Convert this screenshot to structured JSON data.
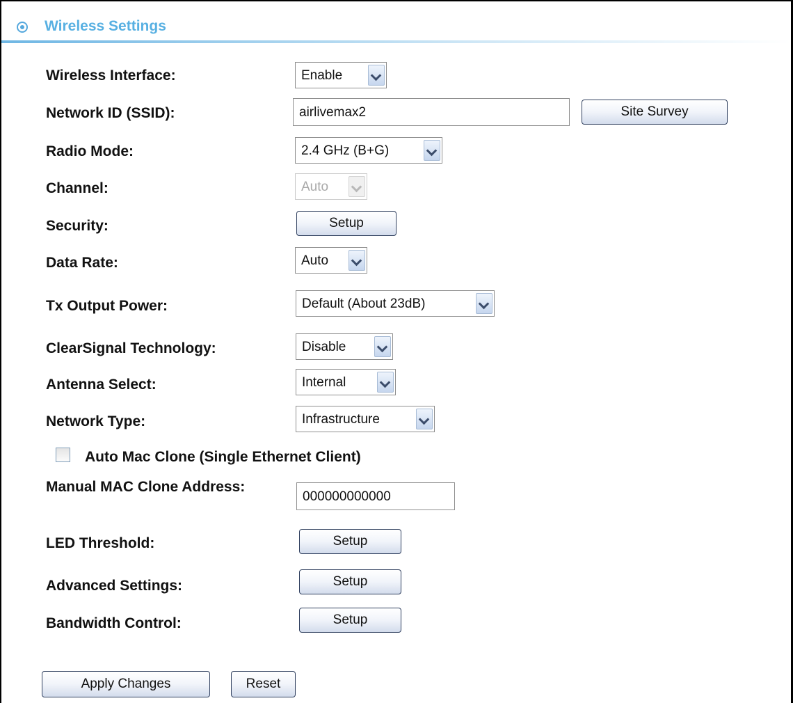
{
  "header": {
    "title": "Wireless Settings",
    "icon": "target-icon",
    "accent_color": "#58b0e2"
  },
  "wireless_interface": {
    "label": "Wireless Interface:",
    "value": "Enable"
  },
  "network_id": {
    "label": "Network ID (SSID):",
    "value": "airlivemax2",
    "site_survey_label": "Site Survey"
  },
  "radio_mode": {
    "label": "Radio Mode:",
    "value": "2.4 GHz (B+G)"
  },
  "channel": {
    "label": "Channel:",
    "value": "Auto",
    "disabled": true
  },
  "security": {
    "label": "Security:",
    "button_label": "Setup"
  },
  "data_rate": {
    "label": "Data Rate:",
    "value": "Auto"
  },
  "tx_output_power": {
    "label": "Tx Output Power:",
    "value": "Default (About 23dB)"
  },
  "clearsignal": {
    "label": "ClearSignal Technology:",
    "value": "Disable"
  },
  "antenna_select": {
    "label": "Antenna Select:",
    "value": "Internal"
  },
  "network_type": {
    "label": "Network Type:",
    "value": "Infrastructure"
  },
  "auto_mac_clone": {
    "label": "Auto Mac Clone (Single Ethernet Client)",
    "checked": false
  },
  "manual_mac_clone": {
    "label": "Manual MAC Clone Address:",
    "value": "000000000000"
  },
  "led_threshold": {
    "label": "LED Threshold:",
    "button_label": "Setup"
  },
  "advanced_settings": {
    "label": "Advanced Settings:",
    "button_label": "Setup"
  },
  "bandwidth_control": {
    "label": "Bandwidth Control:",
    "button_label": "Setup"
  },
  "actions": {
    "apply_label": "Apply Changes",
    "reset_label": "Reset"
  }
}
